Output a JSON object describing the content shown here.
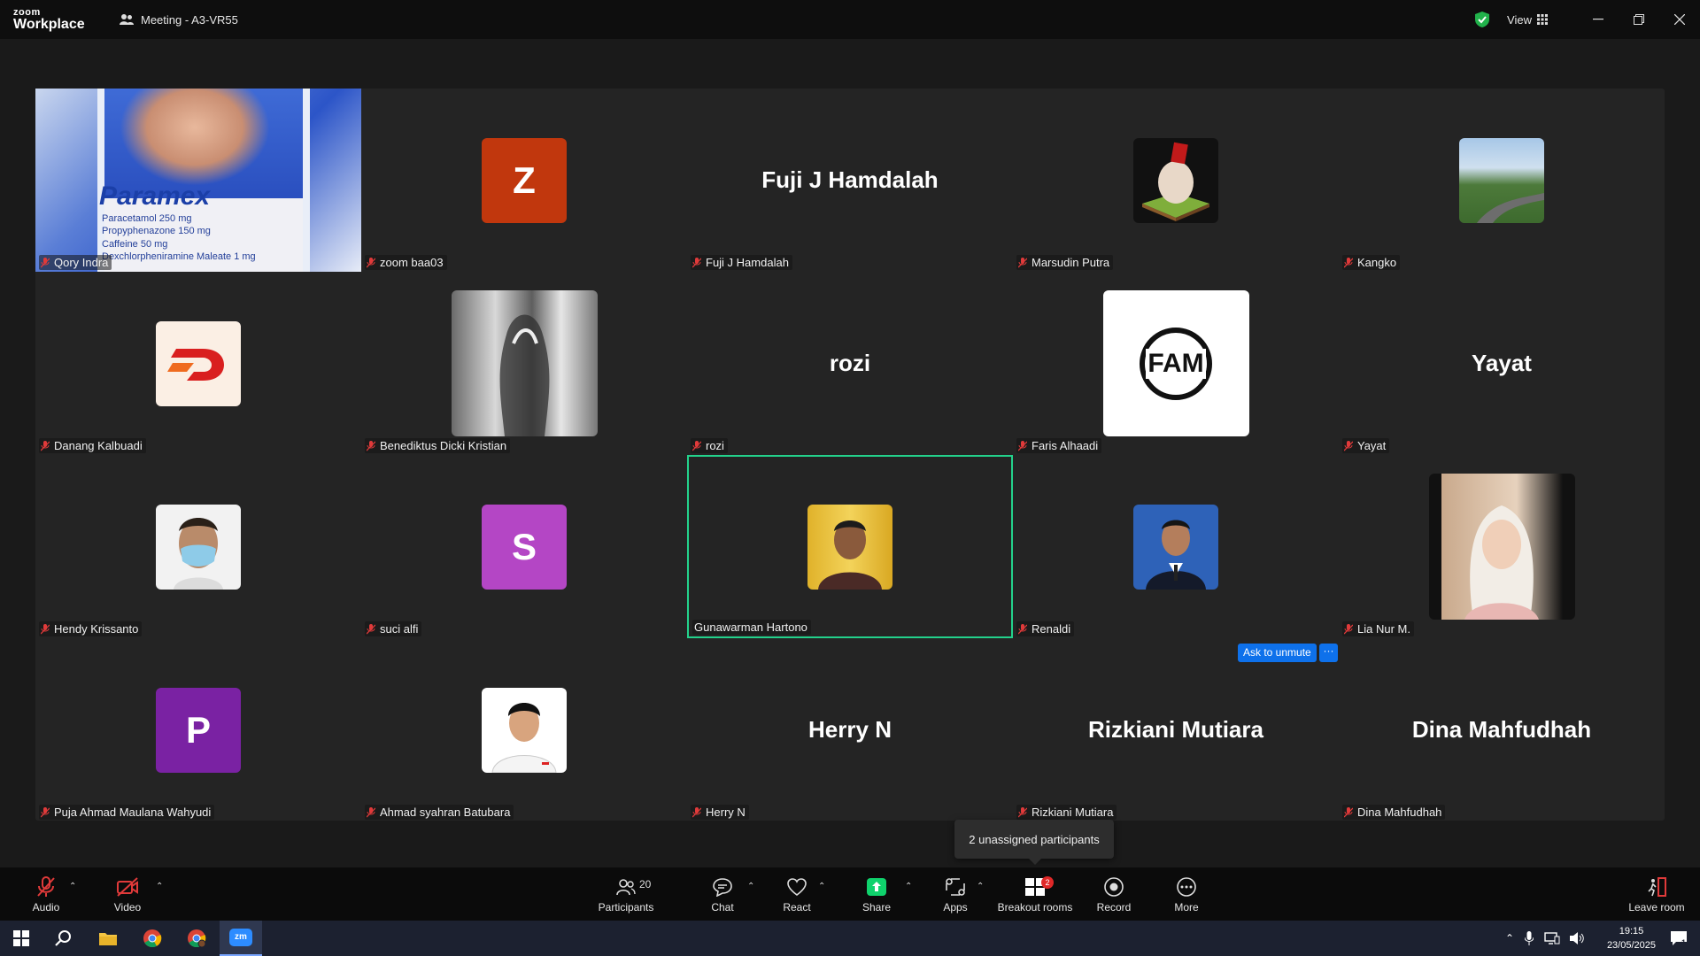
{
  "app": {
    "logo_top": "zoom",
    "logo_bottom": "Workplace",
    "meeting_title": "Meeting - A3-VR55",
    "view_label": "View"
  },
  "first_video": {
    "brand": "Paramex",
    "lines": [
      "Paracetamol 250 mg",
      "Propyphenazone 150 mg",
      "Caffeine 50 mg",
      "Dexchlorpheniramine Maleate 1 mg"
    ]
  },
  "participants": [
    {
      "name": "Qory Indra",
      "kind": "video"
    },
    {
      "name": "zoom baa03",
      "kind": "letter",
      "letter": "Z",
      "color": "#c1370d"
    },
    {
      "name": "Fuji J Hamdalah",
      "kind": "text",
      "display": "Fuji J Hamdalah"
    },
    {
      "name": "Marsudin Putra",
      "kind": "picture",
      "icon": "fist-cube-image"
    },
    {
      "name": "Kangko",
      "kind": "picture",
      "icon": "road-landscape-image"
    },
    {
      "name": "Danang Kalbuadi",
      "kind": "picture",
      "icon": "d-logo-image"
    },
    {
      "name": "Benediktus Dicki Kristian",
      "kind": "picture",
      "icon": "trophy-image"
    },
    {
      "name": "rozi",
      "kind": "text",
      "display": "rozi"
    },
    {
      "name": "Faris Alhaadi",
      "kind": "picture",
      "icon": "fam-logo-image",
      "logo_text": "FAM"
    },
    {
      "name": "Yayat",
      "kind": "text",
      "display": "Yayat"
    },
    {
      "name": "Hendy Krissanto",
      "kind": "picture",
      "icon": "masked-person-image"
    },
    {
      "name": "suci alfi",
      "kind": "letter",
      "letter": "S",
      "color": "#b446c5"
    },
    {
      "name": "Gunawarman Hartono",
      "kind": "picture",
      "icon": "person-portrait-image",
      "active": true
    },
    {
      "name": "Renaldi",
      "kind": "picture",
      "icon": "suit-portrait-image"
    },
    {
      "name": "Lia Nur M.",
      "kind": "picture",
      "icon": "hijab-portrait-image"
    },
    {
      "name": "Puja Ahmad Maulana Wahyudi",
      "kind": "letter",
      "letter": "P",
      "color": "#7a22a3"
    },
    {
      "name": "Ahmad syahran Batubara",
      "kind": "picture",
      "icon": "student-portrait-image"
    },
    {
      "name": "Herry N",
      "kind": "text",
      "display": "Herry N"
    },
    {
      "name": "Rizkiani Mutiara",
      "kind": "text",
      "display": "Rizkiani Mutiara"
    },
    {
      "name": "Dina Mahfudhah",
      "kind": "text",
      "display": "Dina Mahfudhah"
    }
  ],
  "ask_unmute": {
    "label": "Ask to unmute",
    "more": "···"
  },
  "tooltip": "2 unassigned participants",
  "toolbar": {
    "audio": "Audio",
    "video": "Video",
    "participants": "Participants",
    "participants_count": "20",
    "chat": "Chat",
    "react": "React",
    "share": "Share",
    "apps": "Apps",
    "breakout": "Breakout rooms",
    "breakout_badge": "2",
    "record": "Record",
    "more": "More",
    "leave": "Leave room"
  },
  "taskbar": {
    "time": "19:15",
    "date": "23/05/2025",
    "zoom_app": "zm",
    "notifications": "1"
  },
  "colors": {
    "accent_green": "#23d18b",
    "accent_blue": "#0e71eb",
    "share_green": "#0fd26c"
  }
}
